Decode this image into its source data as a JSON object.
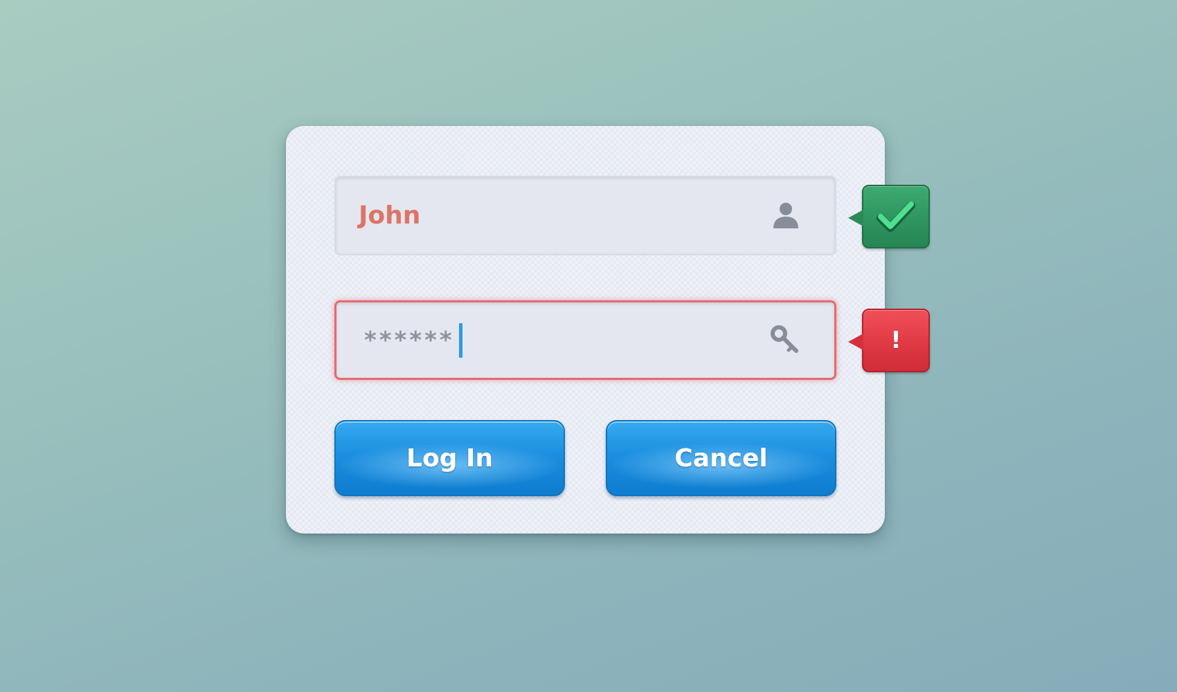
{
  "login_form": {
    "username": {
      "value": "John",
      "icon": "user-icon",
      "status_icon": "checkmark-icon"
    },
    "password": {
      "value": "******",
      "icon": "key-icon",
      "status_label": "!",
      "status_icon": "alert-icon"
    },
    "buttons": {
      "login_label": "Log In",
      "cancel_label": "Cancel"
    }
  },
  "colors": {
    "background": "#9ac1bd",
    "card": "#eef1f8",
    "field": "#e4e7ef",
    "username_text": "#dd7467",
    "error_border": "#e46a6f",
    "success_badge": "#2e9560",
    "error_badge": "#e03a44",
    "button": "#1c8fe0",
    "caret": "#2e9be6"
  }
}
